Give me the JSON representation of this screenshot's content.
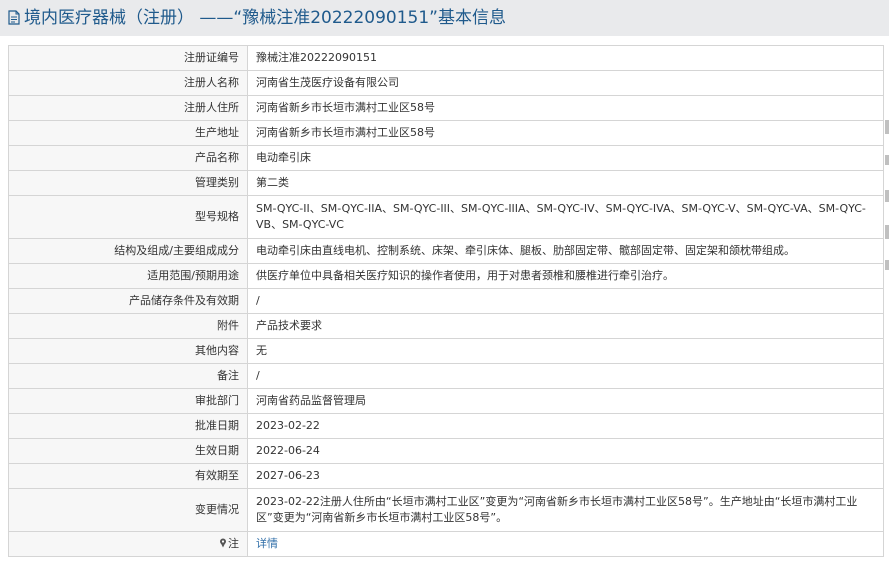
{
  "header": {
    "title": "境内医疗器械（注册） ——“豫械注准20222090151”基本信息",
    "icon": "document-icon"
  },
  "rows": [
    {
      "label": "注册证编号",
      "value": "豫械注准20222090151"
    },
    {
      "label": "注册人名称",
      "value": "河南省生茂医疗设备有限公司"
    },
    {
      "label": "注册人住所",
      "value": "河南省新乡市长垣市满村工业区58号"
    },
    {
      "label": "生产地址",
      "value": "河南省新乡市长垣市满村工业区58号"
    },
    {
      "label": "产品名称",
      "value": "电动牵引床"
    },
    {
      "label": "管理类别",
      "value": "第二类"
    },
    {
      "label": "型号规格",
      "value": "SM-QYC-II、SM-QYC-IIA、SM-QYC-III、SM-QYC-IIIA、SM-QYC-IV、SM-QYC-IVA、SM-QYC-V、SM-QYC-VA、SM-QYC-VB、SM-QYC-VC"
    },
    {
      "label": "结构及组成/主要组成成分",
      "value": "电动牵引床由直线电机、控制系统、床架、牵引床体、腿板、肋部固定带、髋部固定带、固定架和颌枕带组成。"
    },
    {
      "label": "适用范围/预期用途",
      "value": "供医疗单位中具备相关医疗知识的操作者使用，用于对患者颈椎和腰椎进行牵引治疗。"
    },
    {
      "label": "产品储存条件及有效期",
      "value": "/"
    },
    {
      "label": "附件",
      "value": "产品技术要求"
    },
    {
      "label": "其他内容",
      "value": "无"
    },
    {
      "label": "备注",
      "value": "/"
    },
    {
      "label": "审批部门",
      "value": "河南省药品监督管理局"
    },
    {
      "label": "批准日期",
      "value": "2023-02-22"
    },
    {
      "label": "生效日期",
      "value": "2022-06-24"
    },
    {
      "label": "有效期至",
      "value": "2027-06-23"
    },
    {
      "label": "变更情况",
      "value": "2023-02-22注册人住所由“长垣市满村工业区”变更为“河南省新乡市长垣市满村工业区58号”。生产地址由“长垣市满村工业区”变更为“河南省新乡市长垣市满村工业区58号”。"
    }
  ],
  "note_row": {
    "label": "注",
    "icon": "pin-icon",
    "link_text": "详情"
  },
  "colors": {
    "title_bar_bg": "#e9eaec",
    "title_text": "#1f5a8c",
    "border": "#d5d5d5",
    "label_bg": "#f7f7f7",
    "link": "#2f6ea8"
  }
}
